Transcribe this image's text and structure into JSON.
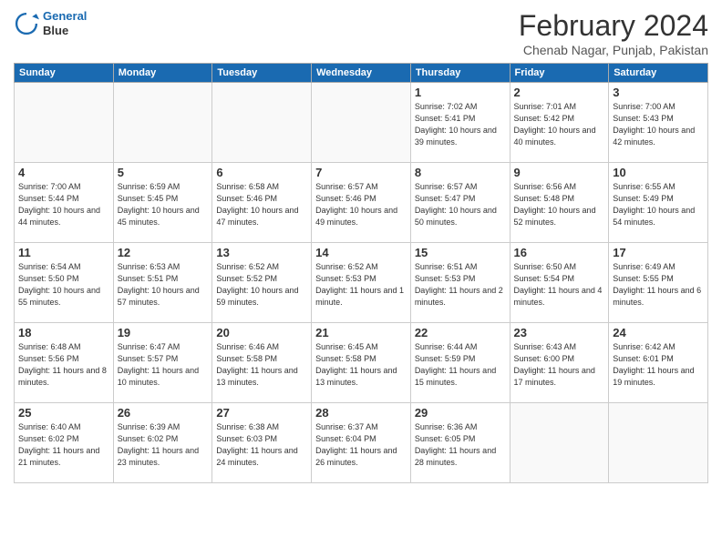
{
  "logo": {
    "line1": "General",
    "line2": "Blue"
  },
  "title": "February 2024",
  "location": "Chenab Nagar, Punjab, Pakistan",
  "days_header": [
    "Sunday",
    "Monday",
    "Tuesday",
    "Wednesday",
    "Thursday",
    "Friday",
    "Saturday"
  ],
  "weeks": [
    [
      {
        "num": "",
        "info": ""
      },
      {
        "num": "",
        "info": ""
      },
      {
        "num": "",
        "info": ""
      },
      {
        "num": "",
        "info": ""
      },
      {
        "num": "1",
        "info": "Sunrise: 7:02 AM\nSunset: 5:41 PM\nDaylight: 10 hours\nand 39 minutes."
      },
      {
        "num": "2",
        "info": "Sunrise: 7:01 AM\nSunset: 5:42 PM\nDaylight: 10 hours\nand 40 minutes."
      },
      {
        "num": "3",
        "info": "Sunrise: 7:00 AM\nSunset: 5:43 PM\nDaylight: 10 hours\nand 42 minutes."
      }
    ],
    [
      {
        "num": "4",
        "info": "Sunrise: 7:00 AM\nSunset: 5:44 PM\nDaylight: 10 hours\nand 44 minutes."
      },
      {
        "num": "5",
        "info": "Sunrise: 6:59 AM\nSunset: 5:45 PM\nDaylight: 10 hours\nand 45 minutes."
      },
      {
        "num": "6",
        "info": "Sunrise: 6:58 AM\nSunset: 5:46 PM\nDaylight: 10 hours\nand 47 minutes."
      },
      {
        "num": "7",
        "info": "Sunrise: 6:57 AM\nSunset: 5:46 PM\nDaylight: 10 hours\nand 49 minutes."
      },
      {
        "num": "8",
        "info": "Sunrise: 6:57 AM\nSunset: 5:47 PM\nDaylight: 10 hours\nand 50 minutes."
      },
      {
        "num": "9",
        "info": "Sunrise: 6:56 AM\nSunset: 5:48 PM\nDaylight: 10 hours\nand 52 minutes."
      },
      {
        "num": "10",
        "info": "Sunrise: 6:55 AM\nSunset: 5:49 PM\nDaylight: 10 hours\nand 54 minutes."
      }
    ],
    [
      {
        "num": "11",
        "info": "Sunrise: 6:54 AM\nSunset: 5:50 PM\nDaylight: 10 hours\nand 55 minutes."
      },
      {
        "num": "12",
        "info": "Sunrise: 6:53 AM\nSunset: 5:51 PM\nDaylight: 10 hours\nand 57 minutes."
      },
      {
        "num": "13",
        "info": "Sunrise: 6:52 AM\nSunset: 5:52 PM\nDaylight: 10 hours\nand 59 minutes."
      },
      {
        "num": "14",
        "info": "Sunrise: 6:52 AM\nSunset: 5:53 PM\nDaylight: 11 hours\nand 1 minute."
      },
      {
        "num": "15",
        "info": "Sunrise: 6:51 AM\nSunset: 5:53 PM\nDaylight: 11 hours\nand 2 minutes."
      },
      {
        "num": "16",
        "info": "Sunrise: 6:50 AM\nSunset: 5:54 PM\nDaylight: 11 hours\nand 4 minutes."
      },
      {
        "num": "17",
        "info": "Sunrise: 6:49 AM\nSunset: 5:55 PM\nDaylight: 11 hours\nand 6 minutes."
      }
    ],
    [
      {
        "num": "18",
        "info": "Sunrise: 6:48 AM\nSunset: 5:56 PM\nDaylight: 11 hours\nand 8 minutes."
      },
      {
        "num": "19",
        "info": "Sunrise: 6:47 AM\nSunset: 5:57 PM\nDaylight: 11 hours\nand 10 minutes."
      },
      {
        "num": "20",
        "info": "Sunrise: 6:46 AM\nSunset: 5:58 PM\nDaylight: 11 hours\nand 13 minutes."
      },
      {
        "num": "21",
        "info": "Sunrise: 6:45 AM\nSunset: 5:58 PM\nDaylight: 11 hours\nand 13 minutes."
      },
      {
        "num": "22",
        "info": "Sunrise: 6:44 AM\nSunset: 5:59 PM\nDaylight: 11 hours\nand 15 minutes."
      },
      {
        "num": "23",
        "info": "Sunrise: 6:43 AM\nSunset: 6:00 PM\nDaylight: 11 hours\nand 17 minutes."
      },
      {
        "num": "24",
        "info": "Sunrise: 6:42 AM\nSunset: 6:01 PM\nDaylight: 11 hours\nand 19 minutes."
      }
    ],
    [
      {
        "num": "25",
        "info": "Sunrise: 6:40 AM\nSunset: 6:02 PM\nDaylight: 11 hours\nand 21 minutes."
      },
      {
        "num": "26",
        "info": "Sunrise: 6:39 AM\nSunset: 6:02 PM\nDaylight: 11 hours\nand 23 minutes."
      },
      {
        "num": "27",
        "info": "Sunrise: 6:38 AM\nSunset: 6:03 PM\nDaylight: 11 hours\nand 24 minutes."
      },
      {
        "num": "28",
        "info": "Sunrise: 6:37 AM\nSunset: 6:04 PM\nDaylight: 11 hours\nand 26 minutes."
      },
      {
        "num": "29",
        "info": "Sunrise: 6:36 AM\nSunset: 6:05 PM\nDaylight: 11 hours\nand 28 minutes."
      },
      {
        "num": "",
        "info": ""
      },
      {
        "num": "",
        "info": ""
      }
    ]
  ]
}
